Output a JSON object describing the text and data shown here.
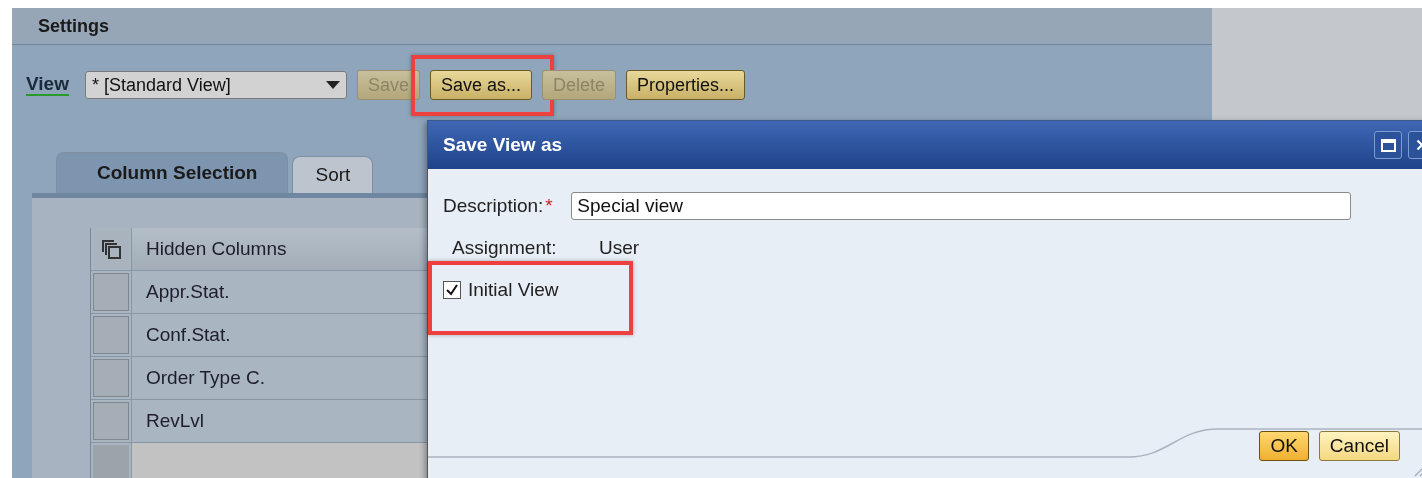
{
  "panel": {
    "title": "Settings"
  },
  "view_bar": {
    "label": "View",
    "dropdown": {
      "value": "* [Standard View]"
    },
    "buttons": [
      {
        "label": "Save",
        "disabled": true,
        "highlighted": false
      },
      {
        "label": "Save as...",
        "disabled": false,
        "highlighted": true
      },
      {
        "label": "Delete",
        "disabled": true,
        "highlighted": false
      },
      {
        "label": "Properties...",
        "disabled": false,
        "highlighted": false
      }
    ]
  },
  "tabs": [
    {
      "label": "Column Selection",
      "selected": true
    },
    {
      "label": "Sort",
      "selected": false
    }
  ],
  "table": {
    "columns": [
      "Hidden Columns"
    ],
    "rows": [
      "Appr.Stat.",
      "Conf.Stat.",
      "Order Type C.",
      "RevLvl"
    ]
  },
  "dialog": {
    "title": "Save View as",
    "fields": [
      {
        "kind": "input",
        "label": "Description:",
        "required_mark": "*",
        "value": "Special view"
      },
      {
        "kind": "text",
        "label": "Assignment:",
        "value": "User"
      },
      {
        "kind": "checkbox",
        "label": "Initial View",
        "checked": true,
        "highlighted": true
      }
    ],
    "buttons": [
      {
        "label": "OK",
        "default": true
      },
      {
        "label": "Cancel",
        "default": false
      }
    ]
  }
}
